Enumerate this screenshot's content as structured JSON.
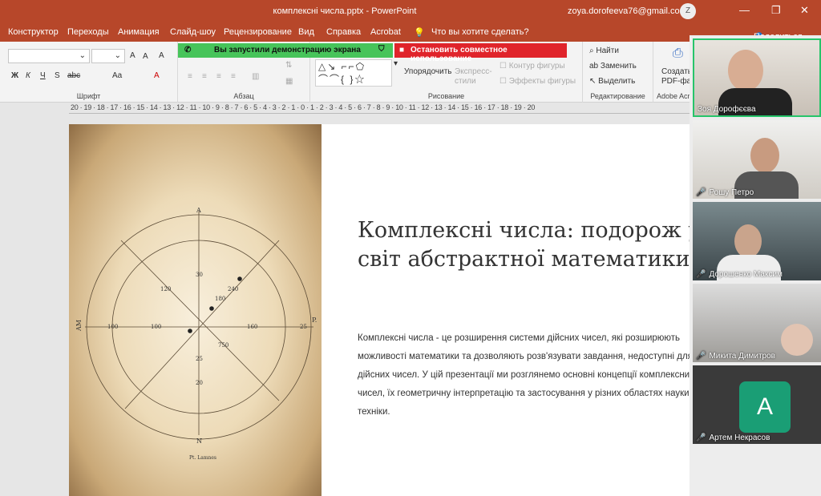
{
  "title": {
    "file": "комплексні числа.pptx",
    "sep": "-",
    "app": "PowerPoint",
    "user": "zoya.dorofeeva76@gmail.com",
    "avatar": "Z",
    "minimize": "—",
    "restore": "❐",
    "close": "✕"
  },
  "tabs": [
    "Конструктор",
    "Переходы",
    "Анимация",
    "Слайд-шоу",
    "Рецензирование",
    "Вид",
    "Справка",
    "Acrobat"
  ],
  "tell_me": "Что вы хотите сделать?",
  "share": "Поделиться",
  "banners": {
    "screen": "Вы запустили демонстрацию экрана",
    "stop": "Остановить совместное использование"
  },
  "ribbon": {
    "font": {
      "label": "Шрифт",
      "bold": "Ж",
      "italic": "К",
      "underline": "Ч",
      "strike": "S",
      "abc": "abc",
      "grow": "A",
      "shrink": "A",
      "clear": "A",
      "aa": "Aa",
      "color": "A"
    },
    "paragraph": {
      "label": "Абзац"
    },
    "drawing": {
      "label": "Рисование",
      "arrange": "Упорядочить",
      "quick_styles": "Экспресс-\nстили",
      "outline": "Контур фигуры",
      "effects": "Эффекты фигуры"
    },
    "editing": {
      "label": "Редактирование",
      "find": "Найти",
      "replace": "Заменить",
      "select": "Выделить"
    },
    "acrobat": {
      "label": "Adobe Acr",
      "create": "Создать",
      "pdf": "PDF-фа"
    }
  },
  "ruler": "20 · 19 · 18 · 17 · 16 · 15 · 14 · 13 · 12 · 11 · 10 · 9 · 8 · 7 · 6 · 5 · 4 · 3 · 2 · 1 · 0 · 1 · 2 · 3 · 4 · 5 · 6 · 7 · 8 · 9 · 10 · 11 · 12 · 13 · 14 · 15 · 16 · 17 · 18 · 19 · 20",
  "slide": {
    "title": "Комплексні числа: подорож у світ абстрактної математики",
    "body": "Комплексні числа - це розширення системи дійсних чисел, які розширюють можливості математики та дозволяють розв'язувати завдання, недоступні для дійсних чисел. У цій презентації ми розглянемо основні концепції комплексних чисел, їх геометричну інтерпретацію та застосування у різних областях науки і техніки.",
    "diagram": {
      "top": "A",
      "bottom": "N",
      "left": "AM",
      "right": "P.",
      "n30": "30",
      "n120": "120",
      "n240": "240",
      "n180": "180",
      "n100a": "100",
      "n100b": "100",
      "n160": "160",
      "n25a": "25",
      "n750": "750",
      "n25b": "25",
      "n20": "20",
      "caption": "Pt. Lamnes"
    }
  },
  "participants": [
    {
      "name": "Зоя Дорофєєва",
      "muted": false
    },
    {
      "name": "Рошу Петро",
      "muted": true
    },
    {
      "name": "Дорошенко Максим",
      "muted": true
    },
    {
      "name": "Микита Димитров",
      "muted": true
    },
    {
      "name": "Артем Некрасов",
      "muted": true,
      "initial": "A"
    }
  ],
  "icons": {
    "mic": "🎤"
  },
  "colors": {
    "accent": "#b7472a",
    "banner_green": "#47c45a",
    "banner_red": "#e0242b",
    "avatar": "#1a9e75"
  }
}
